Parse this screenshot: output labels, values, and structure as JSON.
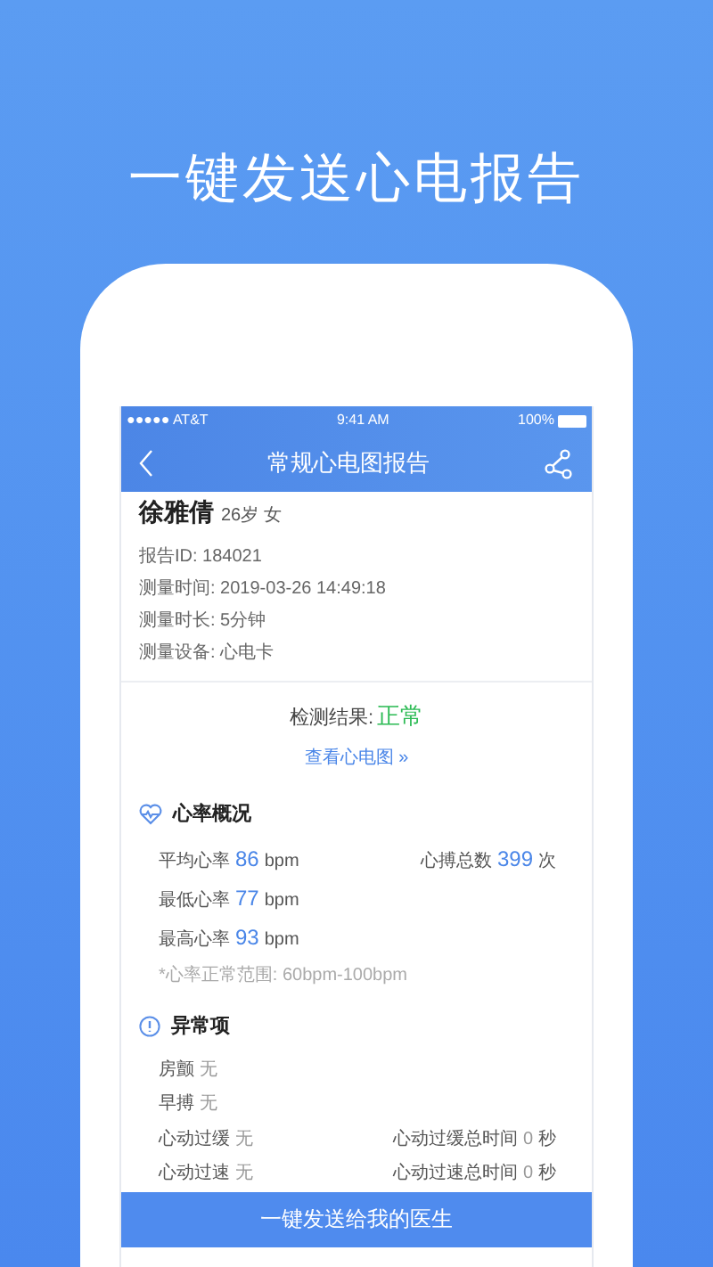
{
  "headline": "一键发送心电报告",
  "status_bar": {
    "carrier": "●●●●● AT&T",
    "time": "9:41 AM",
    "battery": "100%"
  },
  "nav": {
    "title": "常规心电图报告"
  },
  "patient": {
    "name": "徐雅倩",
    "details": "26岁 女"
  },
  "info": [
    "报告ID: 184021",
    "测量时间: 2019-03-26 14:49:18",
    "测量时长: 5分钟",
    "测量设备: 心电卡"
  ],
  "result": {
    "label": "检测结果:",
    "value": "正常"
  },
  "view_link": "查看心电图 »",
  "heart_rate": {
    "title": "心率概况",
    "rows": [
      {
        "label": "平均心率",
        "value": "86",
        "unit": "bpm"
      },
      {
        "label": "最低心率",
        "value": "77",
        "unit": "bpm"
      },
      {
        "label": "最高心率",
        "value": "93",
        "unit": "bpm"
      }
    ],
    "total": {
      "label": "心搏总数",
      "value": "399",
      "unit": "次"
    },
    "note": "*心率正常范围: 60bpm-100bpm"
  },
  "abnormal": {
    "title": "异常项",
    "rows": [
      {
        "label": "房颤",
        "value": "无"
      },
      {
        "label": "早搏",
        "value": "无"
      },
      {
        "label": "心动过缓",
        "value": "无"
      },
      {
        "label": "心动过速",
        "value": "无"
      }
    ],
    "times": [
      {
        "label": "心动过缓总时间",
        "value": "0",
        "unit": "秒"
      },
      {
        "label": "心动过速总时间",
        "value": "0",
        "unit": "秒"
      }
    ]
  },
  "send_button": "一键发送给我的医生"
}
